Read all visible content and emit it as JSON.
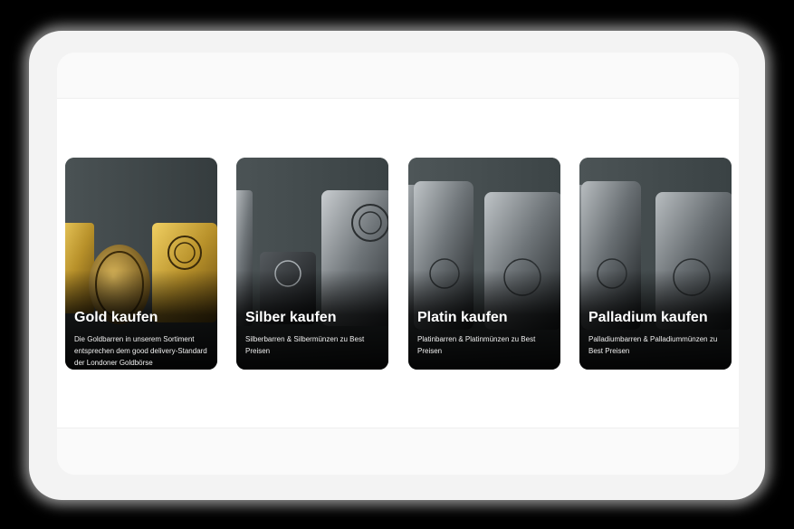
{
  "products": [
    {
      "title": "Gold kaufen",
      "description": "Die Goldbarren in unserem Sortiment entsprechen dem good delivery-Standard der Londoner Goldbörse"
    },
    {
      "title": "Silber kaufen",
      "description": "Silberbarren & Silbermünzen zu Best Preisen"
    },
    {
      "title": "Platin kaufen",
      "description": "Platinbarren & Platinmünzen zu Best Preisen"
    },
    {
      "title": "Palladium kaufen",
      "description": "Palladiumbarren & Palladiummünzen zu Best Preisen"
    }
  ],
  "colors": {
    "gold": "#b8912a",
    "silver": "#8a9094",
    "platinum": "#7c8286",
    "palladium": "#767c80"
  }
}
